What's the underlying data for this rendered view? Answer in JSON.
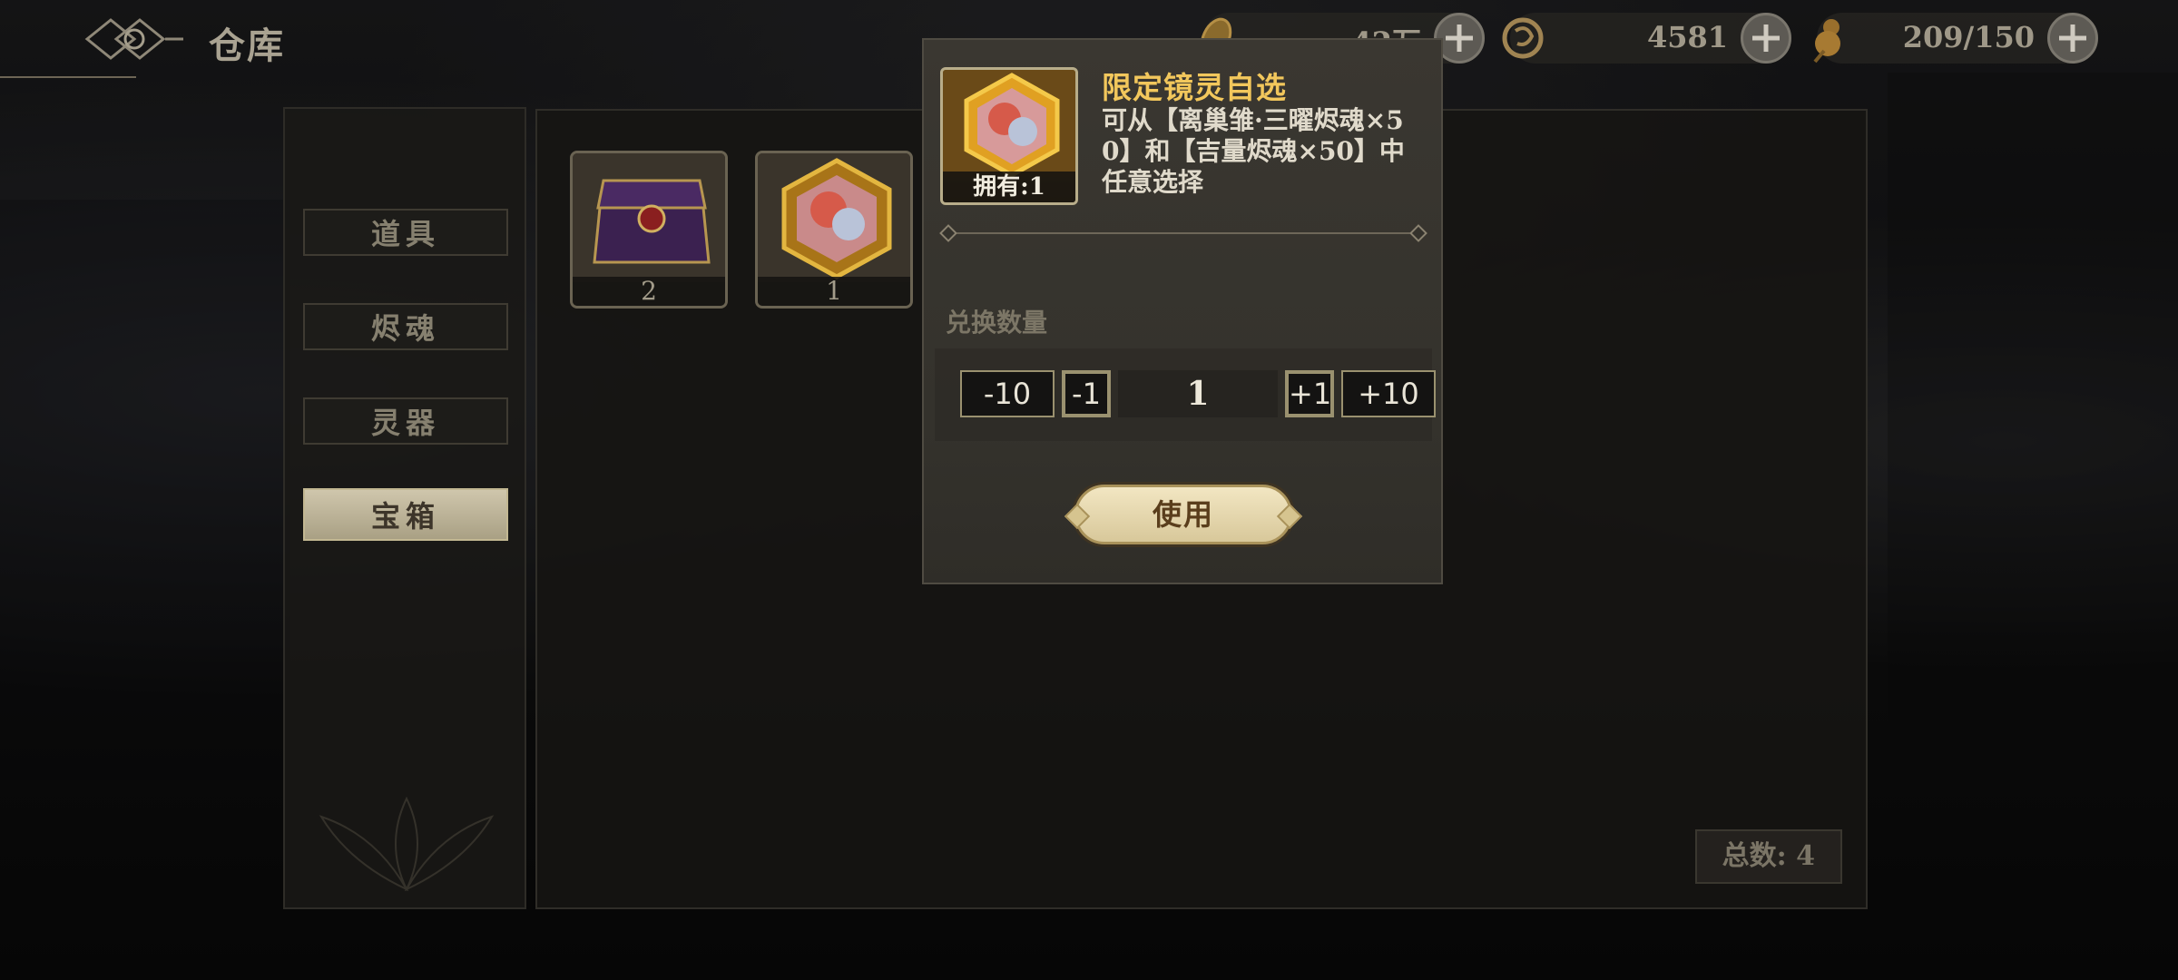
{
  "header": {
    "title": "仓库",
    "logo_icon": "emblem-icon"
  },
  "resources": [
    {
      "icon": "coin-icon",
      "value": "42万"
    },
    {
      "icon": "dragon-token-icon",
      "value": "4581"
    },
    {
      "icon": "gourd-icon",
      "value": "209/150"
    }
  ],
  "sidebar": {
    "items": [
      {
        "label": "道具",
        "active": false
      },
      {
        "label": "烬魂",
        "active": false
      },
      {
        "label": "灵器",
        "active": false
      },
      {
        "label": "宝箱",
        "active": true
      }
    ]
  },
  "inventory": {
    "items": [
      {
        "icon": "treasure-chest-icon",
        "count": "2"
      },
      {
        "icon": "mirror-spirit-portrait-icon",
        "count": "1"
      }
    ],
    "total_label": "总数: 4"
  },
  "popup": {
    "title": "限定镜灵自选",
    "description": "可从【离巢雏·三曜烬魂×50】和【吉量烬魂×50】中任意选择",
    "owned_label": "拥有:1",
    "quantity_label": "兑换数量",
    "quantity": {
      "minus10": "-10",
      "minus1": "-1",
      "value": "1",
      "plus1": "+1",
      "plus10": "+10"
    },
    "use_button": "使用"
  },
  "colors": {
    "accent_gold": "#f2c75c",
    "button_cream": "#e8dcb4",
    "text_light": "#e0dacb"
  }
}
